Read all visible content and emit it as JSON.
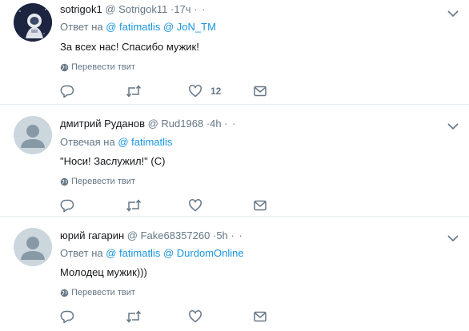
{
  "tweets": [
    {
      "name": "sotrigok1",
      "handle": "@ Sotrigok11",
      "time": "·17ч",
      "dots": "· ·",
      "reply_prefix": "Ответ на",
      "mentions": [
        "@ fatimatlis",
        "@ JoN_TM"
      ],
      "text": "За всех нас! Спасибо мужик!",
      "translate": "Перевести твит",
      "like_count": "12"
    },
    {
      "name": "дмитрий Руданов",
      "handle": "@ Rud1968",
      "time": "·4h",
      "dots": "· ·",
      "reply_prefix": "Отвечая на",
      "mentions": [
        "@ fatimatlis"
      ],
      "text": "\"Носи! Заслужил!\" (С)",
      "translate": "Перевести твит",
      "like_count": ""
    },
    {
      "name": "юрий гагарин",
      "handle": "@ Fake68357260",
      "time": "·5h",
      "dots": "· ·",
      "reply_prefix": "Ответ на",
      "mentions": [
        "@ fatimatlis",
        "@ DurdomOnline"
      ],
      "text": "Молодец мужик)))",
      "translate": "Перевести твит",
      "like_count": ""
    }
  ],
  "colors": {
    "link": "#1b95e0",
    "muted": "#657786",
    "text": "#14171a",
    "divider": "#e6ecf0"
  },
  "icons": [
    "reply-icon",
    "retweet-icon",
    "like-icon",
    "message-icon",
    "globe-icon",
    "chevron-down-icon"
  ]
}
